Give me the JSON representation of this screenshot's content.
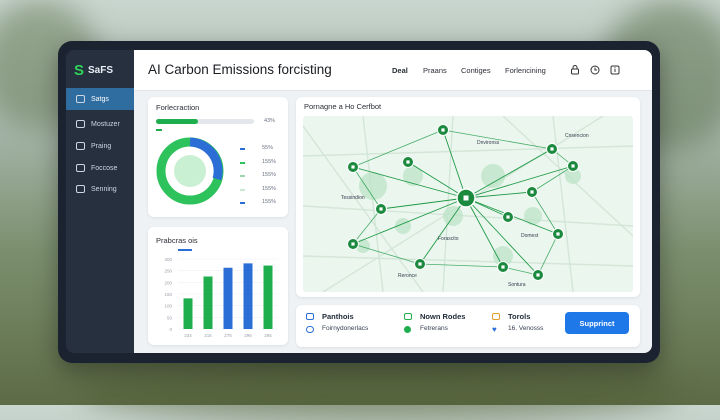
{
  "app": {
    "brand": "SaFS",
    "title": "AI Carbon Emissions forcisting"
  },
  "sidebar": {
    "items": [
      {
        "label": "Satgs",
        "icon": "grid-icon",
        "active": true
      },
      {
        "label": "Mostuzer",
        "icon": "monitor-icon"
      },
      {
        "label": "Praing",
        "icon": "document-icon"
      },
      {
        "label": "Foccose",
        "icon": "calendar-icon"
      },
      {
        "label": "Senning",
        "icon": "settings-icon"
      }
    ]
  },
  "header": {
    "nav": [
      "Deal",
      "Praans",
      "Contiges",
      "Forlencining"
    ],
    "icons": [
      "user-icon",
      "clock-icon",
      "info-icon"
    ]
  },
  "forecast": {
    "title": "Forlecraction",
    "progress_label": "43%",
    "legend": [
      "55%",
      "155%",
      "155%",
      "155%",
      "155%"
    ],
    "progress_colors": [
      "#1fae4d",
      "#2b6fd6"
    ]
  },
  "bars": {
    "title": "Prabcras ois"
  },
  "chart_data": {
    "type": "bar",
    "categories": [
      "234",
      "216",
      "275",
      "296",
      "295"
    ],
    "values": [
      140,
      240,
      280,
      300,
      290
    ],
    "ylim": [
      0,
      320
    ],
    "yticks": [
      "300",
      "250",
      "200",
      "150",
      "100",
      "50",
      "0"
    ],
    "bar_colors": [
      "#1fae4d",
      "#1fae4d",
      "#2b6fd6",
      "#2b6fd6",
      "#1fae4d"
    ]
  },
  "map": {
    "title": "Pornagne a Ho Cerfbot",
    "labels": [
      "Cnsencion",
      "Dnvironss",
      "Tessindion",
      "Forascito",
      "Domest",
      "Reronce",
      "Sontura"
    ]
  },
  "bottom": {
    "items": [
      {
        "title": "Panthois",
        "sub": "Foirnydonerlacs",
        "icon": "chart-icon",
        "sub_icon": "people-icon"
      },
      {
        "title": "Nown Rodes",
        "sub": "Fetrerans",
        "icon": "screen-icon",
        "sub_icon": "check-icon"
      },
      {
        "title": "Torols",
        "sub": "16. Venosss",
        "icon": "folder-icon",
        "sub_icon": "heart-icon"
      }
    ],
    "button": "Supprinct"
  }
}
